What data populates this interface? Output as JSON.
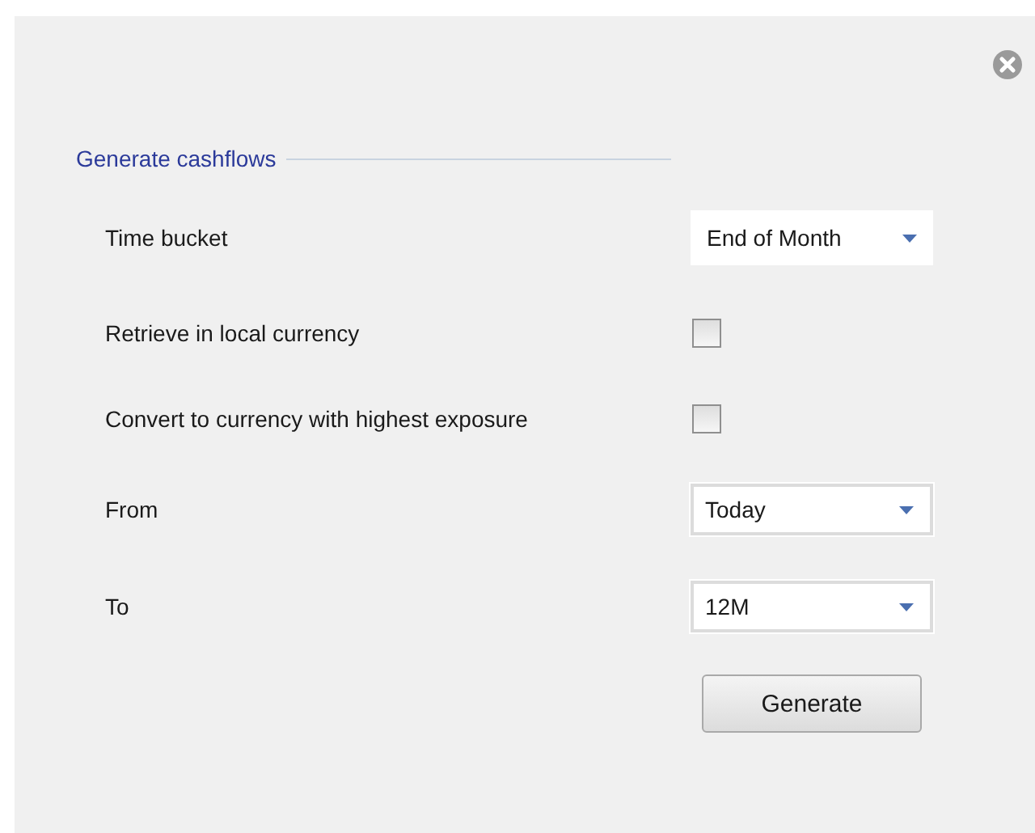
{
  "section": {
    "title": "Generate cashflows"
  },
  "fields": [
    {
      "kind": "dropdown",
      "label": "Time bucket",
      "value": "End of Month",
      "bordered": false
    },
    {
      "kind": "checkbox",
      "label": "Retrieve in local currency",
      "checked": false
    },
    {
      "kind": "checkbox",
      "label": "Convert to currency with highest exposure",
      "checked": false
    },
    {
      "kind": "dropdown",
      "label": "From",
      "value": "Today",
      "bordered": true
    },
    {
      "kind": "dropdown",
      "label": "To",
      "value": "12M",
      "bordered": true
    }
  ],
  "buttons": [
    "Generate"
  ]
}
